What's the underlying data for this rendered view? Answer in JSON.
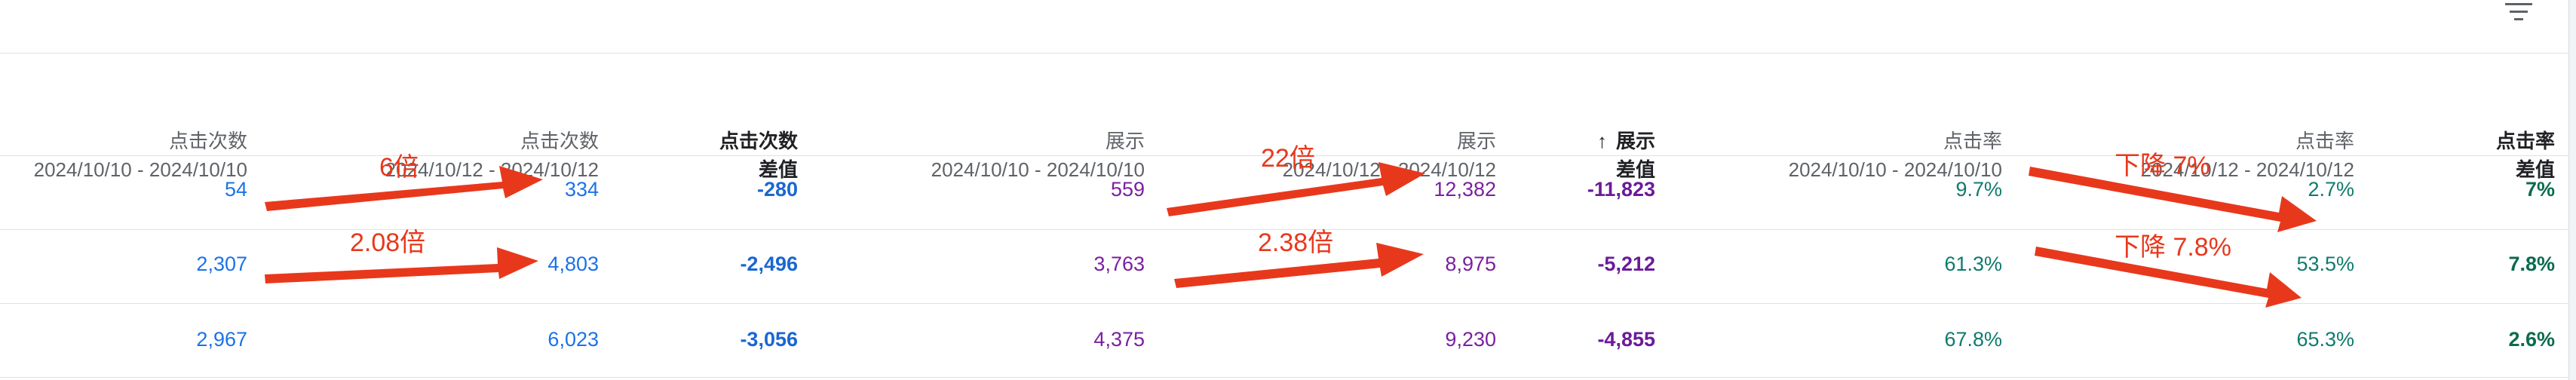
{
  "columns": [
    {
      "title": "点击次数",
      "sub": "2024/10/10 - 2024/10/10"
    },
    {
      "title": "点击次数",
      "sub": "2024/10/12 - 2024/10/12"
    },
    {
      "title": "点击次数",
      "sub": "差值"
    },
    {
      "title": "展示",
      "sub": "2024/10/10 - 2024/10/10"
    },
    {
      "title": "展示",
      "sub": "2024/10/12 - 2024/10/12"
    },
    {
      "title": "展示",
      "sub": "差值",
      "sort_icon": "↑"
    },
    {
      "title": "点击率",
      "sub": "2024/10/10 - 2024/10/10"
    },
    {
      "title": "点击率",
      "sub": "2024/10/12 - 2024/10/12"
    },
    {
      "title": "点击率",
      "sub": "差值"
    }
  ],
  "rows": [
    [
      "54",
      "334",
      "-280",
      "559",
      "12,382",
      "-11,823",
      "9.7%",
      "2.7%",
      "7%"
    ],
    [
      "2,307",
      "4,803",
      "-2,496",
      "3,763",
      "8,975",
      "-5,212",
      "61.3%",
      "53.5%",
      "7.8%"
    ],
    [
      "2,967",
      "6,023",
      "-3,056",
      "4,375",
      "9,230",
      "-4,855",
      "67.8%",
      "65.3%",
      "2.6%"
    ]
  ],
  "annotations": [
    "6倍",
    "22倍",
    "下降 7%",
    "2.08倍",
    "2.38倍",
    "下降 7.8%"
  ],
  "colors": {
    "clicks": "#1a73e8",
    "impressions": "#7b1fa2",
    "ctr": "#0f7b6c",
    "annotation": "#e8381c"
  },
  "icons": {
    "filter": "filter-icon",
    "sort": "arrow-up-icon"
  }
}
